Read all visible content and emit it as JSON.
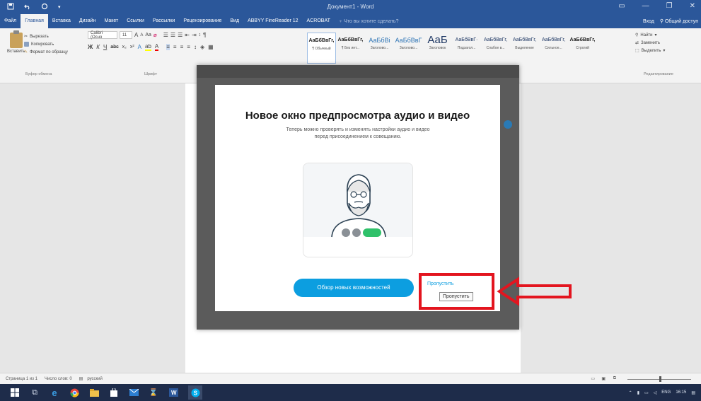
{
  "title_bar": {
    "document_title": "Документ1 - Word",
    "quick_access": [
      "save-icon",
      "undo-icon",
      "redo-icon"
    ],
    "window_controls": [
      "minimize-icon",
      "restore-icon",
      "close-icon"
    ]
  },
  "ribbon_tabs": {
    "items": [
      "Файл",
      "Главная",
      "Вставка",
      "Дизайн",
      "Макет",
      "Ссылки",
      "Рассылки",
      "Рецензирование",
      "Вид",
      "ABBYY FineReader 12",
      "ACROBAT"
    ],
    "active": "Главная",
    "tell_me": "Что вы хотите сделать?",
    "right": {
      "view": "Вход",
      "share": "Общий доступ"
    }
  },
  "ribbon": {
    "clipboard": {
      "paste": "Вставить",
      "cut": "Вырезать",
      "copy": "Копировать",
      "format_painter": "Формат по образцу",
      "group_label": "Буфер обмена"
    },
    "font": {
      "font_name": "Calibri (Осно",
      "font_size": "11",
      "bold": "Ж",
      "italic": "К",
      "underline": "Ч",
      "group_label": "Шрифт"
    },
    "styles": [
      {
        "sample": "АаБбВвГг,",
        "name": "¶ Обычный"
      },
      {
        "sample": "АаБбВвГг,",
        "name": "¶ Без инт..."
      },
      {
        "sample": "АаБбВі",
        "name": "Заголово..."
      },
      {
        "sample": "АаБбВвГ",
        "name": "Заголово..."
      },
      {
        "sample": "АаБ",
        "name": "Заголовок"
      },
      {
        "sample": "АаБбВвГ·",
        "name": "Подзагол..."
      },
      {
        "sample": "АаБбВвГг,",
        "name": "Слабое в..."
      },
      {
        "sample": "АаБбВвГг,",
        "name": "Выделение"
      },
      {
        "sample": "АаБбВвГг,",
        "name": "Сильное..."
      },
      {
        "sample": "АаБбВвГг,",
        "name": "Строгий"
      }
    ],
    "editing": {
      "find": "Найти",
      "replace": "Заменить",
      "select": "Выделить",
      "group_label": "Редактирование"
    }
  },
  "modal": {
    "title": "Новое окно предпросмотра аудио и видео",
    "subtitle_line1": "Теперь можно проверять и изменять настройки аудио и видео",
    "subtitle_line2": "перед присоединением к совещанию.",
    "primary_button": "Обзор новых возможностей",
    "skip_link": "Пропустить",
    "skip_tooltip": "Пропустить"
  },
  "status_bar": {
    "page": "Страница 1 из 1",
    "words": "Число слов: 0",
    "language": "русский"
  },
  "taskbar": {
    "lang": "ENG",
    "time": "16:15"
  },
  "colors": {
    "word_blue": "#2b579a",
    "skype_blue": "#0c9ee0",
    "annotation_red": "#e3151f",
    "taskbar": "#1e2c4a"
  }
}
